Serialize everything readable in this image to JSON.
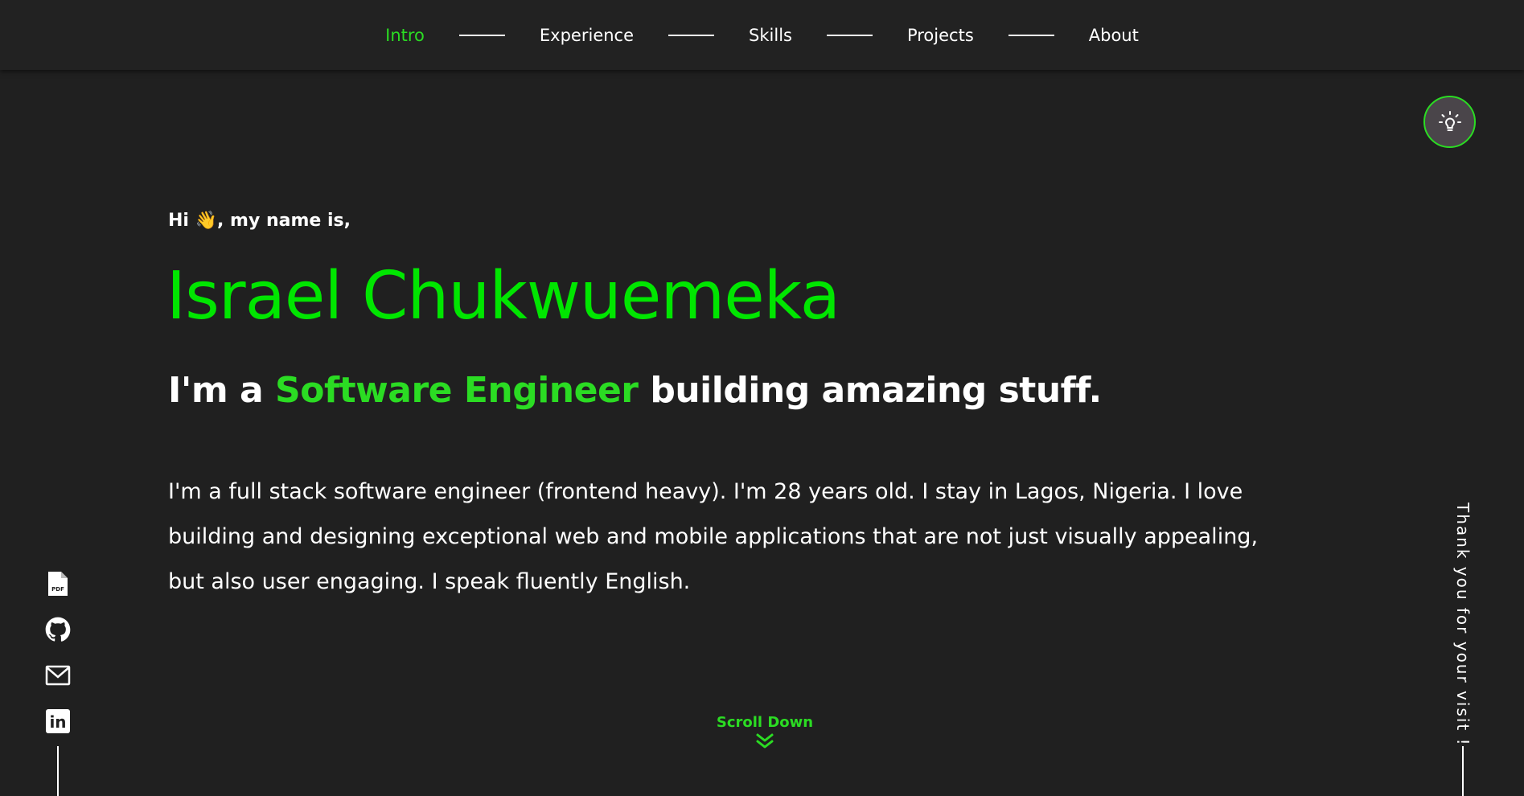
{
  "nav": {
    "items": [
      {
        "label": "Intro",
        "active": true
      },
      {
        "label": "Experience",
        "active": false
      },
      {
        "label": "Skills",
        "active": false
      },
      {
        "label": "Projects",
        "active": false
      },
      {
        "label": "About",
        "active": false
      }
    ]
  },
  "theme_toggle": {
    "icon": "lightbulb-icon"
  },
  "hero": {
    "greeting_prefix": "Hi",
    "greeting_emoji": "👋",
    "greeting_suffix": ", my name is,",
    "name": "Israel Chukwuemeka",
    "tagline_before": "I'm a",
    "tagline_highlight": "Software Engineer",
    "tagline_after": "building amazing stuff.",
    "bio": "I'm a full stack software engineer (frontend heavy). I'm 28 years old. I stay in Lagos, Nigeria. I love building and designing exceptional web and mobile applications that are not just visually appealing, but also user engaging. I speak fluently English."
  },
  "scroll": {
    "label": "Scroll Down"
  },
  "social": {
    "items": [
      {
        "icon": "pdf-file-icon",
        "icon_text": "PDF"
      },
      {
        "icon": "github-icon"
      },
      {
        "icon": "mail-icon"
      },
      {
        "icon": "linkedin-icon",
        "icon_text": "in"
      }
    ]
  },
  "side_text": "Thank you for your visit !",
  "colors": {
    "background": "#202020",
    "nav_background": "#222222",
    "accent": "#2bdc23",
    "name_accent": "#00e600",
    "text": "#ffffff",
    "toggle_background": "#4a454a"
  }
}
